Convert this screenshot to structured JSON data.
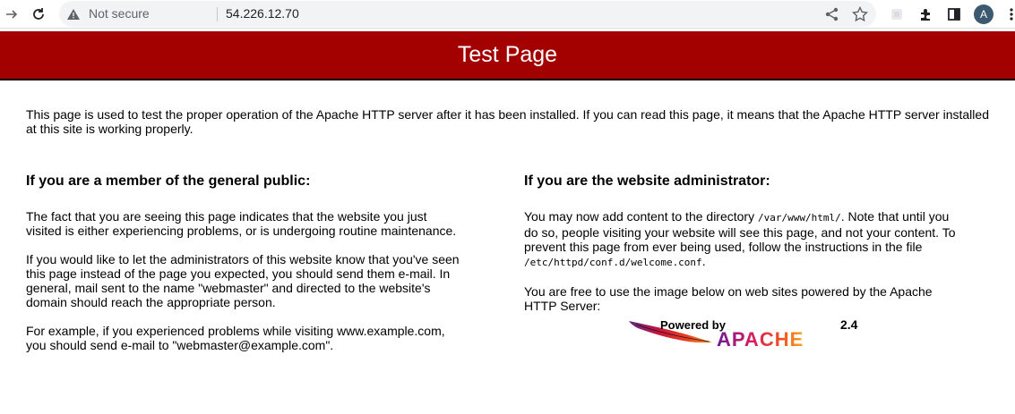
{
  "browser": {
    "security_status": "Not secure",
    "url": "54.226.12.70",
    "avatar_letter": "A"
  },
  "page": {
    "title": "Test Page",
    "intro": "This page is used to test the proper operation of the Apache HTTP server after it has been installed. If you can read this page, it means that the Apache HTTP server installed at this site is working properly.",
    "public_section": {
      "heading": "If you are a member of the general public:",
      "p1": "The fact that you are seeing this page indicates that the website you just visited is either experiencing problems, or is undergoing routine maintenance.",
      "p2": "If you would like to let the administrators of this website know that you've seen this page instead of the page you expected, you should send them e-mail. In general, mail sent to the name \"webmaster\" and directed to the website's domain should reach the appropriate person.",
      "p3": "For example, if you experienced problems while visiting www.example.com, you should send e-mail to \"webmaster@example.com\"."
    },
    "admin_section": {
      "heading": "If you are the website administrator:",
      "p1_a": "You may now add content to the directory ",
      "p1_code1": "/var/www/html/",
      "p1_b": ". Note that until you do so, people visiting your website will see this page, and not your content. To prevent this page from ever being used, follow the instructions in the file ",
      "p1_code2": "/etc/httpd/conf.d/welcome.conf",
      "p1_c": ".",
      "p2": "You are free to use the image below on web sites powered by the Apache HTTP Server:"
    },
    "logo": {
      "powered_by": "Powered by",
      "name": "APACHE",
      "version": "2.4"
    }
  },
  "colors": {
    "banner": "#a30000",
    "toolbar_icon": "#5f6368"
  }
}
